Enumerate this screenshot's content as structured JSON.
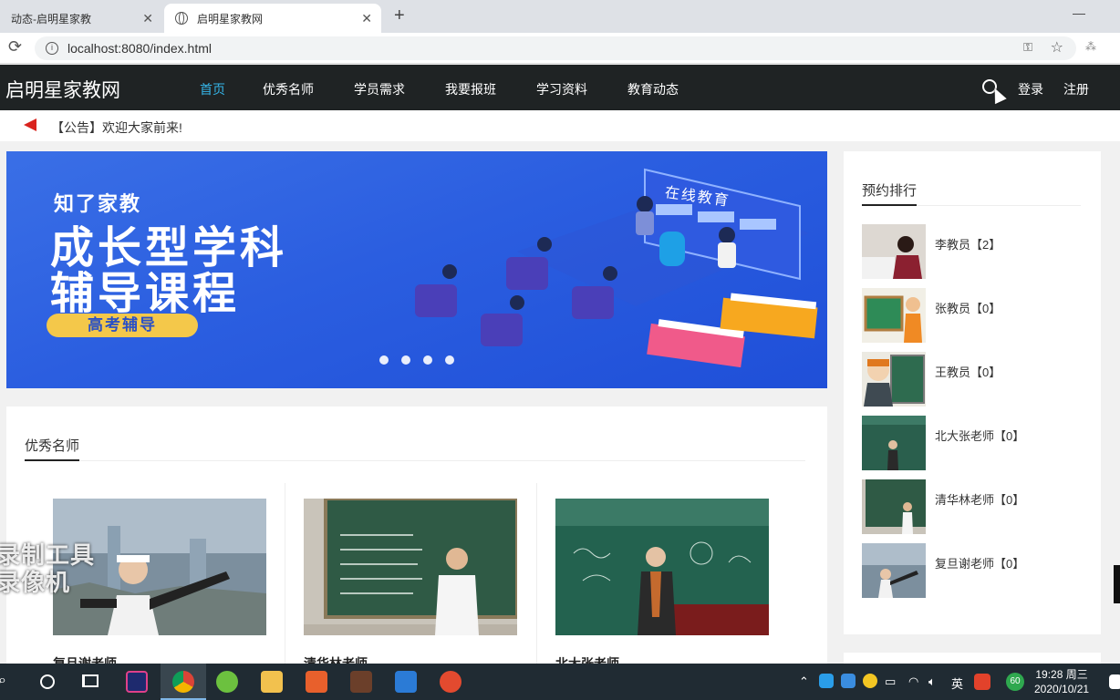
{
  "browser": {
    "tabs": [
      {
        "title": "动态-启明星家教",
        "active": false
      },
      {
        "title": "启明星家教网",
        "active": true
      }
    ],
    "url": "localhost:8080/index.html",
    "close_glyph": "✕",
    "newtab_glyph": "+",
    "minimize_glyph": "—"
  },
  "site": {
    "logo": "启明星家教网",
    "nav": [
      "首页",
      "优秀名师",
      "学员需求",
      "我要报班",
      "学习资料",
      "教育动态"
    ],
    "active_nav": "首页",
    "login": "登录",
    "register": "注册",
    "accent_color": "#35b5e8",
    "navbar_color": "#1f2324"
  },
  "notice": {
    "text": "【公告】欢迎大家前来!"
  },
  "banner": {
    "brand": "知了家教",
    "headline1": "成长型学科",
    "headline2": "辅导课程",
    "tag": "高考辅导",
    "online": "在线教育",
    "slides": 4
  },
  "teachers": {
    "title": "优秀名师",
    "items": [
      {
        "name": "复旦谢老师",
        "photo_icon": "outdoor-city-photo"
      },
      {
        "name": "清华林老师",
        "photo_icon": "blackboard-classroom-photo"
      },
      {
        "name": "北大张老师",
        "photo_icon": "lecture-classroom-photo"
      }
    ]
  },
  "ranking": {
    "title": "预约排行",
    "items": [
      {
        "label": "李教员【2】"
      },
      {
        "label": "张教员【0】"
      },
      {
        "label": "王教员【0】"
      },
      {
        "label": "北大张老师【0】"
      },
      {
        "label": "清华林老师【0】"
      },
      {
        "label": "复旦谢老师【0】"
      }
    ]
  },
  "overlay": {
    "watermark_line1": "录制工具",
    "watermark_line2": "录像机"
  },
  "taskbar": {
    "tray_lang": "英",
    "badge": "60",
    "time": "19:28 周三",
    "date": "2020/10/21"
  }
}
